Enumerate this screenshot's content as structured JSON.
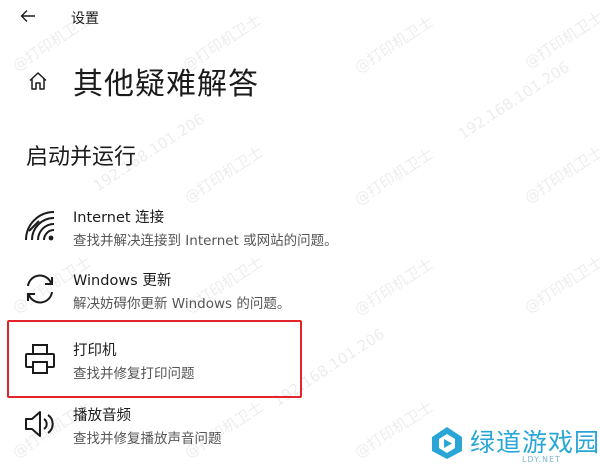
{
  "window": {
    "title": "设置"
  },
  "page": {
    "title": "其他疑难解答"
  },
  "section": {
    "title": "启动并运行"
  },
  "items": [
    {
      "label": "Internet 连接",
      "description": "查找并解决连接到 Internet 或网站的问题。",
      "icon": "wifi-icon"
    },
    {
      "label": "Windows 更新",
      "description": "解决妨碍你更新 Windows 的问题。",
      "icon": "sync-icon"
    },
    {
      "label": "打印机",
      "description": "查找并修复打印问题",
      "icon": "printer-icon"
    },
    {
      "label": "播放音频",
      "description": "查找并修复播放声音问题",
      "icon": "speaker-icon"
    }
  ],
  "highlight": {
    "color": "#e3242b",
    "target": "打印机"
  },
  "watermark": {
    "text": "@打印机卫士",
    "ip": "192.168.101.206"
  },
  "logo": {
    "text": "绿道游戏园",
    "subtext": "LDY.NET",
    "color": "#2aa6d6"
  }
}
